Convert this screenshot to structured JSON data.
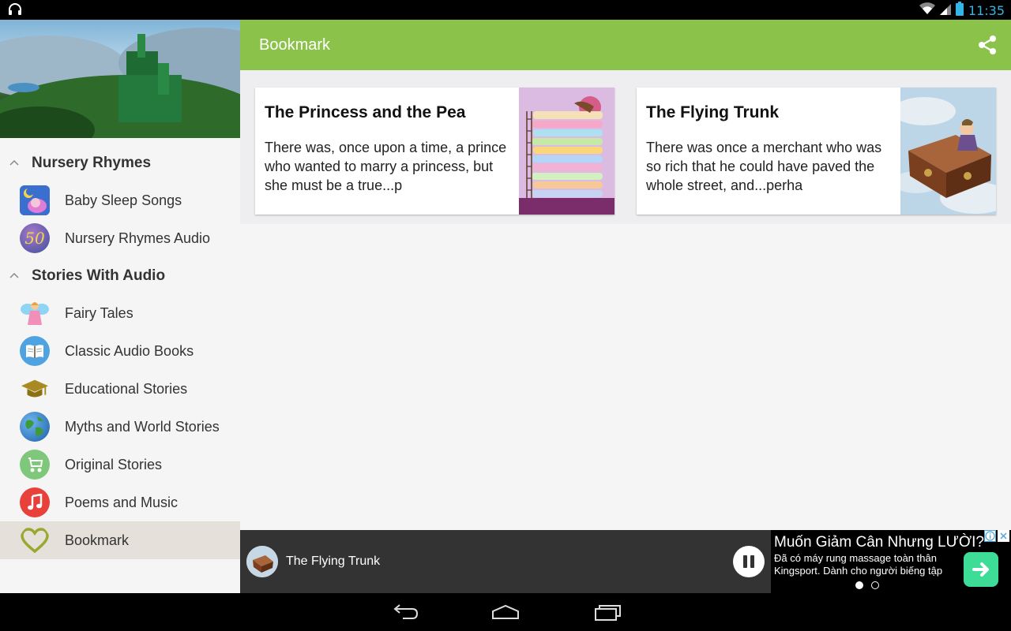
{
  "status_bar": {
    "time": "11:35",
    "icons": [
      "headphones-icon",
      "wifi-icon",
      "signal-icon",
      "battery-icon"
    ]
  },
  "drawer": {
    "sections": [
      {
        "title": "Nursery Rhymes",
        "expanded": true,
        "items": [
          {
            "label": "Baby Sleep Songs",
            "icon": "baby-sleep-icon"
          },
          {
            "label": "Nursery Rhymes Audio",
            "icon": "fifty-badge-icon"
          }
        ]
      },
      {
        "title": "Stories With Audio",
        "expanded": true,
        "items": [
          {
            "label": "Fairy Tales",
            "icon": "fairy-icon"
          },
          {
            "label": "Classic Audio Books",
            "icon": "book-icon"
          },
          {
            "label": "Educational Stories",
            "icon": "graduation-cap-icon"
          },
          {
            "label": "Myths and World Stories",
            "icon": "globe-icon"
          },
          {
            "label": "Original Stories",
            "icon": "stroller-icon"
          },
          {
            "label": "Poems and Music",
            "icon": "music-note-icon"
          },
          {
            "label": "Bookmark",
            "icon": "heart-icon",
            "selected": true
          }
        ]
      }
    ],
    "header_badge": "50"
  },
  "appbar": {
    "title": "Bookmark",
    "share_icon": "share-icon"
  },
  "cards": [
    {
      "title": "The Princess and the Pea",
      "excerpt": "There was, once upon a time, a prince who wanted to marry a princess, but she must be a true...p",
      "image": "princess-on-mattresses"
    },
    {
      "title": "The Flying Trunk",
      "excerpt": "There was once a merchant who was so rich that he could have paved the whole street, and...perha",
      "image": "flying-trunk"
    }
  ],
  "player": {
    "title": "The Flying Trunk",
    "state": "playing"
  },
  "ad": {
    "headline": "Muốn Giảm Cân Nhưng LƯỜI?",
    "body": "Đã có máy rung massage toàn thân Kingsport. Dành cho người biếng tập",
    "page": 1,
    "page_count": 2
  },
  "colors": {
    "accent": "#8bc34a",
    "status_time": "#33b5e5",
    "selected_item_bg": "#e6e0da",
    "player_bg": "#333333",
    "ad_button": "#3ddc97"
  }
}
